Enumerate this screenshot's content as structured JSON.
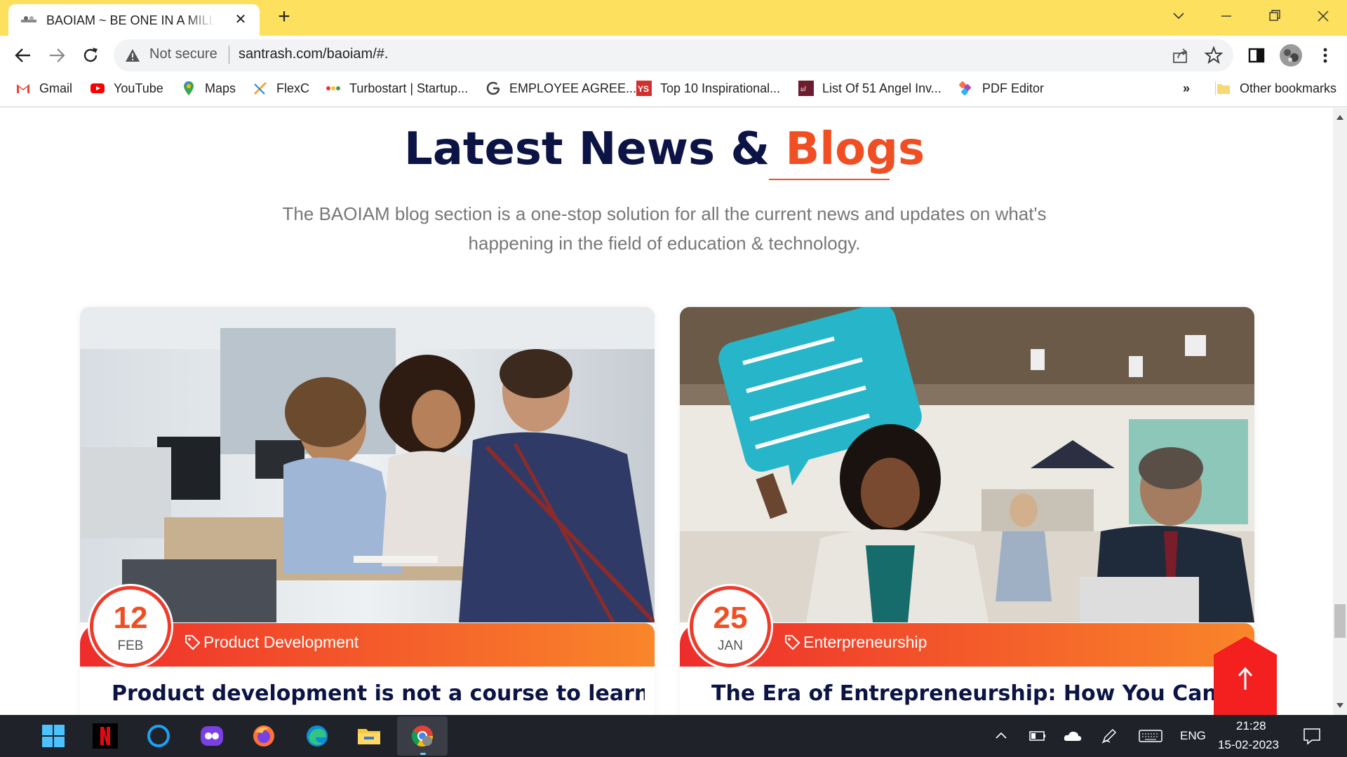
{
  "browser": {
    "tab_title": "BAOIAM ~ BE ONE IN A MILLION",
    "not_secure_label": "Not secure",
    "url": "santrash.com/baoiam/#."
  },
  "bookmarks": [
    {
      "label": "Gmail",
      "icon": "gmail-icon"
    },
    {
      "label": "YouTube",
      "icon": "youtube-icon"
    },
    {
      "label": "Maps",
      "icon": "maps-icon"
    },
    {
      "label": "FlexC",
      "icon": "flexc-icon"
    },
    {
      "label": "Turbostart | Startup...",
      "icon": "turbostart-icon"
    },
    {
      "label": "EMPLOYEE AGREE...",
      "icon": "google-icon"
    },
    {
      "label": "Top 10 Inspirational...",
      "icon": "ys-icon"
    },
    {
      "label": "List Of 51 Angel Inv...",
      "icon": "list-icon"
    },
    {
      "label": "PDF Editor",
      "icon": "pdf-editor-icon"
    }
  ],
  "bookmarks_overflow": "»",
  "other_bookmarks": "Other bookmarks",
  "page": {
    "heading_main": "Latest News & ",
    "heading_accent": "Blogs",
    "intro": "The BAOIAM blog section is a one-stop solution for all the current news and updates on what's happening in the field of education & technology.",
    "cards": [
      {
        "day": "12",
        "month": "FEB",
        "tag": "Product Development",
        "title": "Product development is not a course to learn, its"
      },
      {
        "day": "25",
        "month": "JAN",
        "tag": "Enterpreneurship",
        "title": "The Era of Entrepreneurship: How You Can Be the"
      }
    ]
  },
  "taskbar": {
    "language": "ENG",
    "time": "21:28",
    "date": "15-02-2023"
  },
  "colors": {
    "titlebar": "#fde15e",
    "heading": "#0c1445",
    "accent": "#f04e23",
    "band_start": "#ee2d2b",
    "band_end": "#f9862a"
  }
}
